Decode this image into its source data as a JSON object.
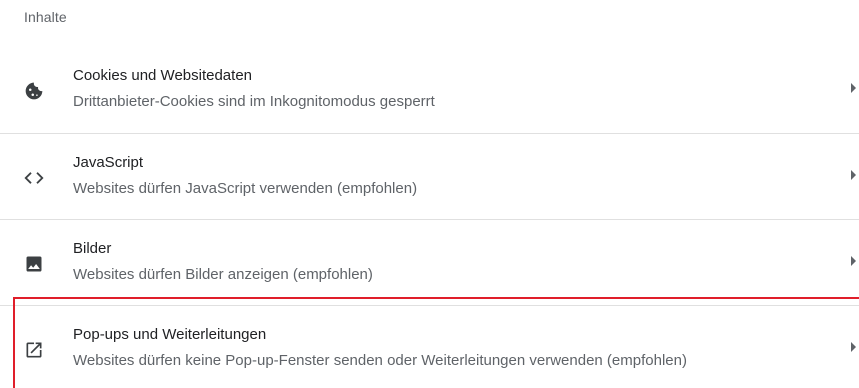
{
  "section": {
    "title": "Inhalte"
  },
  "items": [
    {
      "title": "Cookies und Websitedaten",
      "subtitle": "Drittanbieter-Cookies sind im Inkognitomodus gesperrt",
      "icon": "cookie-icon"
    },
    {
      "title": "JavaScript",
      "subtitle": "Websites dürfen JavaScript verwenden (empfohlen)",
      "icon": "code-icon"
    },
    {
      "title": "Bilder",
      "subtitle": "Websites dürfen Bilder anzeigen (empfohlen)",
      "icon": "image-icon"
    },
    {
      "title": "Pop-ups und Weiterleitungen",
      "subtitle": "Websites dürfen keine Pop-up-Fenster senden oder Weiterleitungen verwenden (empfohlen)",
      "icon": "open-in-new-icon"
    }
  ],
  "colors": {
    "highlight": "#e01e2a",
    "text_primary": "#202124",
    "text_secondary": "#5f6368",
    "divider": "#e0e0e0"
  }
}
